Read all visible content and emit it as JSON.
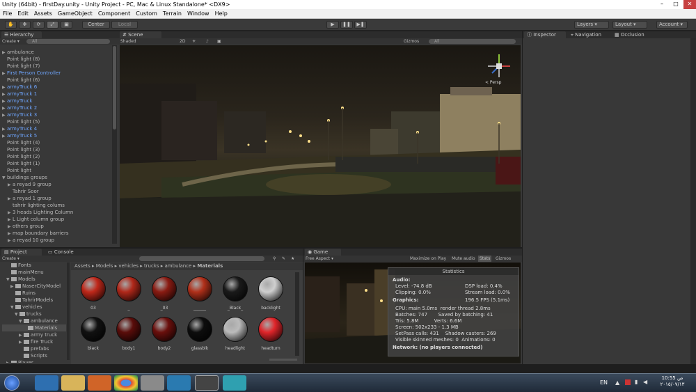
{
  "window": {
    "title": "Unity (64bit) - firstDay.unity - Unity Project - PC, Mac & Linux Standalone* <DX9>"
  },
  "menu": [
    "File",
    "Edit",
    "Assets",
    "GameObject",
    "Component",
    "Custom",
    "Terrain",
    "Window",
    "Help"
  ],
  "toolbar": {
    "pivot": "Center",
    "space": "Local",
    "layers": "Layers",
    "layout": "Layout",
    "account": "Account"
  },
  "hierarchy": {
    "tab": "Hierarchy",
    "create": "Create",
    "search": "All",
    "items": [
      {
        "label": "ambulance",
        "indent": 0,
        "arrow": "right",
        "blue": false
      },
      {
        "label": "Point light (8)",
        "indent": 0,
        "arrow": "",
        "blue": false
      },
      {
        "label": "Point light (7)",
        "indent": 0,
        "arrow": "",
        "blue": false
      },
      {
        "label": "First Person Controller",
        "indent": 0,
        "arrow": "right",
        "blue": true
      },
      {
        "label": "Point light (6)",
        "indent": 0,
        "arrow": "",
        "blue": false
      },
      {
        "label": "armyTruck 6",
        "indent": 0,
        "arrow": "right",
        "blue": true
      },
      {
        "label": "armyTruck 1",
        "indent": 0,
        "arrow": "right",
        "blue": true
      },
      {
        "label": "armyTruck",
        "indent": 0,
        "arrow": "right",
        "blue": true
      },
      {
        "label": "armyTruck 2",
        "indent": 0,
        "arrow": "right",
        "blue": true
      },
      {
        "label": "armyTruck 3",
        "indent": 0,
        "arrow": "right",
        "blue": true
      },
      {
        "label": "Point light (5)",
        "indent": 0,
        "arrow": "",
        "blue": false
      },
      {
        "label": "armyTruck 4",
        "indent": 0,
        "arrow": "right",
        "blue": true
      },
      {
        "label": "armyTruck 5",
        "indent": 0,
        "arrow": "right",
        "blue": true
      },
      {
        "label": "Point light (4)",
        "indent": 0,
        "arrow": "",
        "blue": false
      },
      {
        "label": "Point light (3)",
        "indent": 0,
        "arrow": "",
        "blue": false
      },
      {
        "label": "Point light (2)",
        "indent": 0,
        "arrow": "",
        "blue": false
      },
      {
        "label": "Point light (1)",
        "indent": 0,
        "arrow": "",
        "blue": false
      },
      {
        "label": "Point light",
        "indent": 0,
        "arrow": "",
        "blue": false
      },
      {
        "label": "buildings groups",
        "indent": 0,
        "arrow": "down",
        "blue": false
      },
      {
        "label": "a reyad 9 group",
        "indent": 1,
        "arrow": "right",
        "blue": false
      },
      {
        "label": "Tahrir Soor",
        "indent": 1,
        "arrow": "",
        "blue": false
      },
      {
        "label": "a reyad 1 group",
        "indent": 1,
        "arrow": "right",
        "blue": false
      },
      {
        "label": "tahrir lighting colums",
        "indent": 1,
        "arrow": "",
        "blue": false
      },
      {
        "label": "3 heads Lighting Column",
        "indent": 1,
        "arrow": "right",
        "blue": false
      },
      {
        "label": "L Light column group",
        "indent": 1,
        "arrow": "right",
        "blue": false
      },
      {
        "label": "others group",
        "indent": 1,
        "arrow": "right",
        "blue": false
      },
      {
        "label": "map boundary barriers",
        "indent": 1,
        "arrow": "right",
        "blue": false
      },
      {
        "label": "a reyad 10 group",
        "indent": 1,
        "arrow": "right",
        "blue": false
      }
    ]
  },
  "scene": {
    "tab": "Scene",
    "shading": "Shaded",
    "mode2d": "2D",
    "gizmos": "Gizmos",
    "search": "All",
    "persp": "< Persp"
  },
  "inspector": {
    "tab": "Inspector",
    "tab2": "Navigation",
    "tab3": "Occlusion"
  },
  "project": {
    "tab": "Project",
    "tab2": "Console",
    "create": "Create",
    "tree": [
      {
        "label": "Fonts",
        "indent": 1,
        "arrow": ""
      },
      {
        "label": "mainMenu",
        "indent": 1,
        "arrow": ""
      },
      {
        "label": "Models",
        "indent": 1,
        "arrow": "down"
      },
      {
        "label": "NaserCityModel",
        "indent": 2,
        "arrow": "right"
      },
      {
        "label": "Ruins",
        "indent": 2,
        "arrow": ""
      },
      {
        "label": "TahrirModels",
        "indent": 2,
        "arrow": ""
      },
      {
        "label": "vehicles",
        "indent": 2,
        "arrow": "down"
      },
      {
        "label": "trucks",
        "indent": 3,
        "arrow": "down"
      },
      {
        "label": "ambulance",
        "indent": 4,
        "arrow": "down"
      },
      {
        "label": "Materials",
        "indent": 5,
        "arrow": "",
        "selected": true
      },
      {
        "label": "army truck",
        "indent": 4,
        "arrow": "right"
      },
      {
        "label": "fire Truck",
        "indent": 4,
        "arrow": "right"
      },
      {
        "label": "prefabs",
        "indent": 4,
        "arrow": ""
      },
      {
        "label": "Scripts",
        "indent": 4,
        "arrow": ""
      },
      {
        "label": "Player",
        "indent": 1,
        "arrow": "right"
      }
    ],
    "breadcrumb": [
      "Assets",
      "Models",
      "vehicles",
      "trucks",
      "ambulance",
      "Materials"
    ],
    "materials": [
      {
        "name": "03",
        "color": "#c0281a"
      },
      {
        "name": "_",
        "color": "#b0281a"
      },
      {
        "name": "_03",
        "color": "#8a1b12"
      },
      {
        "name": "______",
        "color": "#b0301a"
      },
      {
        "name": "_Black_",
        "color": "#1a1a1a"
      },
      {
        "name": "backlight",
        "color": "#cfcfcf"
      },
      {
        "name": "black",
        "color": "#111111"
      },
      {
        "name": "body1",
        "color": "#5a0d0a"
      },
      {
        "name": "body2",
        "color": "#6a0f0c"
      },
      {
        "name": "glassblk",
        "color": "#0d0d0d"
      },
      {
        "name": "headlight",
        "color": "#bbbbbb"
      },
      {
        "name": "headturn",
        "color": "#e0252a"
      }
    ]
  },
  "game": {
    "tab": "Game",
    "aspect": "Free Aspect",
    "maximize": "Maximize on Play",
    "mute": "Mute audio",
    "stats": "Stats",
    "gizmos": "Gizmos"
  },
  "stats": {
    "title": "Statistics",
    "audio_h": "Audio:",
    "level": "Level: -74.8 dB",
    "clipping": "Clipping: 0.0%",
    "dsp": "DSP load: 0.4%",
    "stream": "Stream load: 0.0%",
    "graphics_h": "Graphics:",
    "fps": "196.5 FPS (5.1ms)",
    "lines": [
      "CPU: main 5.0ms  render thread 2.8ms",
      "Batches: 747       Saved by batching: 41",
      "Tris: 5.8M          Verts: 6.6M",
      "Screen: 502x233 - 1.3 MB",
      "SetPass calls: 431    Shadow casters: 269",
      "Visible skinned meshes: 0  Animations: 0"
    ],
    "network": "Network: (no players connected)"
  },
  "taskbar": {
    "lang": "EN",
    "time": "10:55 ص",
    "date": "٢٠١٥/٠٧/١٣"
  }
}
